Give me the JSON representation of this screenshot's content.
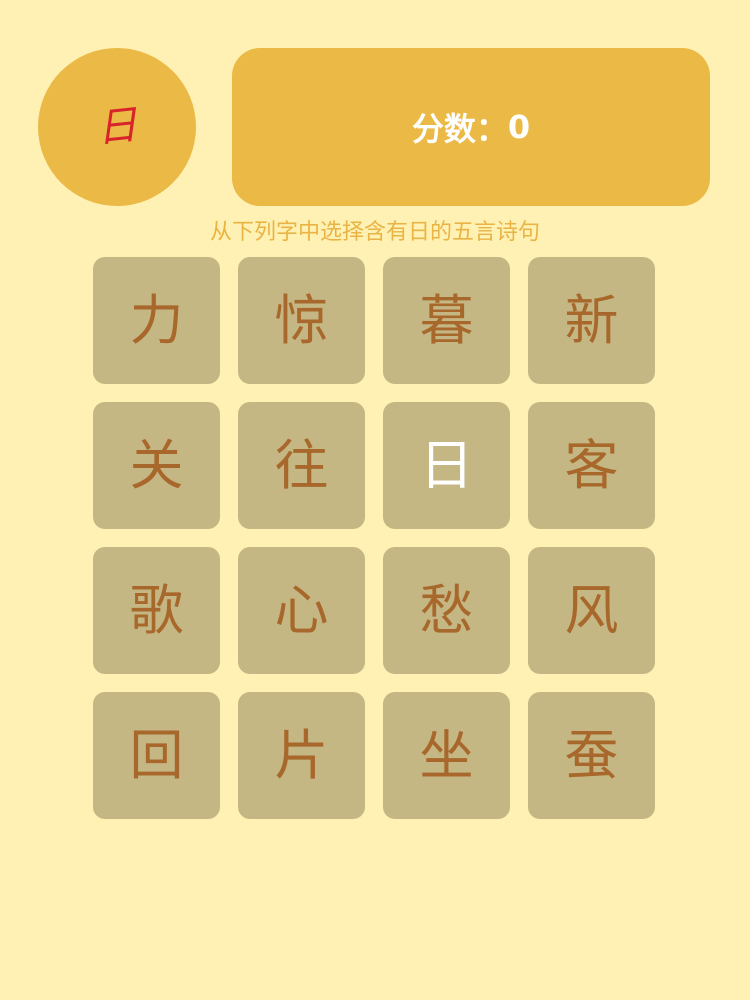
{
  "target_char": "日",
  "score": {
    "label": "分数：",
    "value": "0"
  },
  "instruction": "从下列字中选择含有日的五言诗句",
  "grid": {
    "selected_index": 6,
    "tiles": [
      "力",
      "惊",
      "暮",
      "新",
      "关",
      "往",
      "日",
      "客",
      "歌",
      "心",
      "愁",
      "风",
      "回",
      "片",
      "坐",
      "蚕"
    ]
  },
  "colors": {
    "background": "#fff1b3",
    "accent": "#ebb945",
    "tile": "#c4b784",
    "tile_text": "#a8682c",
    "target_char": "#d8232a",
    "selected_text": "#ffffff"
  }
}
